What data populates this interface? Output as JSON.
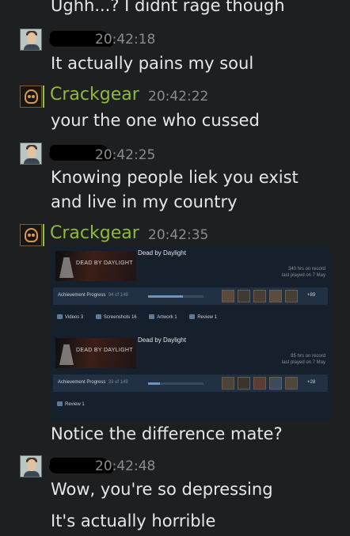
{
  "messages": {
    "m0": {
      "text": "Ughh...? I didnt rage though"
    },
    "m1": {
      "time": "20:42:18",
      "lines": [
        "It actually pains my soul"
      ]
    },
    "m2": {
      "name": "Crackgear",
      "time": "20:42:22",
      "lines": [
        "your the one who cussed"
      ]
    },
    "m3": {
      "time": "20:42:25",
      "lines": [
        "Knowing people liek you exist",
        "and live in my country"
      ]
    },
    "m4": {
      "name": "Crackgear",
      "time": "20:42:35",
      "lines": [
        "Notice the difference mate?"
      ]
    },
    "m5": {
      "time": "20:42:48",
      "lines": [
        "Wow, you're so depressing",
        "It's actually horrible"
      ]
    }
  },
  "cards": [
    {
      "banner_logo": "DEAD BY DAYLIGHT",
      "game": "Dead by Daylight",
      "hours": "340 hrs on record",
      "last_played": "last played on 7 May",
      "ach_label": "Achievement Progress",
      "ach_count": "94 of 149",
      "progress_fraction": 0.63,
      "ach_more": "+89",
      "stats": [
        "Videos 3",
        "Screenshots 16",
        "Artwork 1",
        "Review 1"
      ]
    },
    {
      "banner_logo": "DEAD BY DAYLIGHT",
      "game": "Dead by Daylight",
      "hours": "85 hrs on record",
      "last_played": "last played on 7 May",
      "ach_label": "Achievement Progress",
      "ach_count": "33 of 149",
      "progress_fraction": 0.22,
      "ach_more": "+28",
      "stats": [
        "Review 1"
      ]
    }
  ],
  "colors": {
    "accent_name": "#90ba3c",
    "timestamp": "#8b8c8d",
    "card_bg": "#16202d"
  }
}
